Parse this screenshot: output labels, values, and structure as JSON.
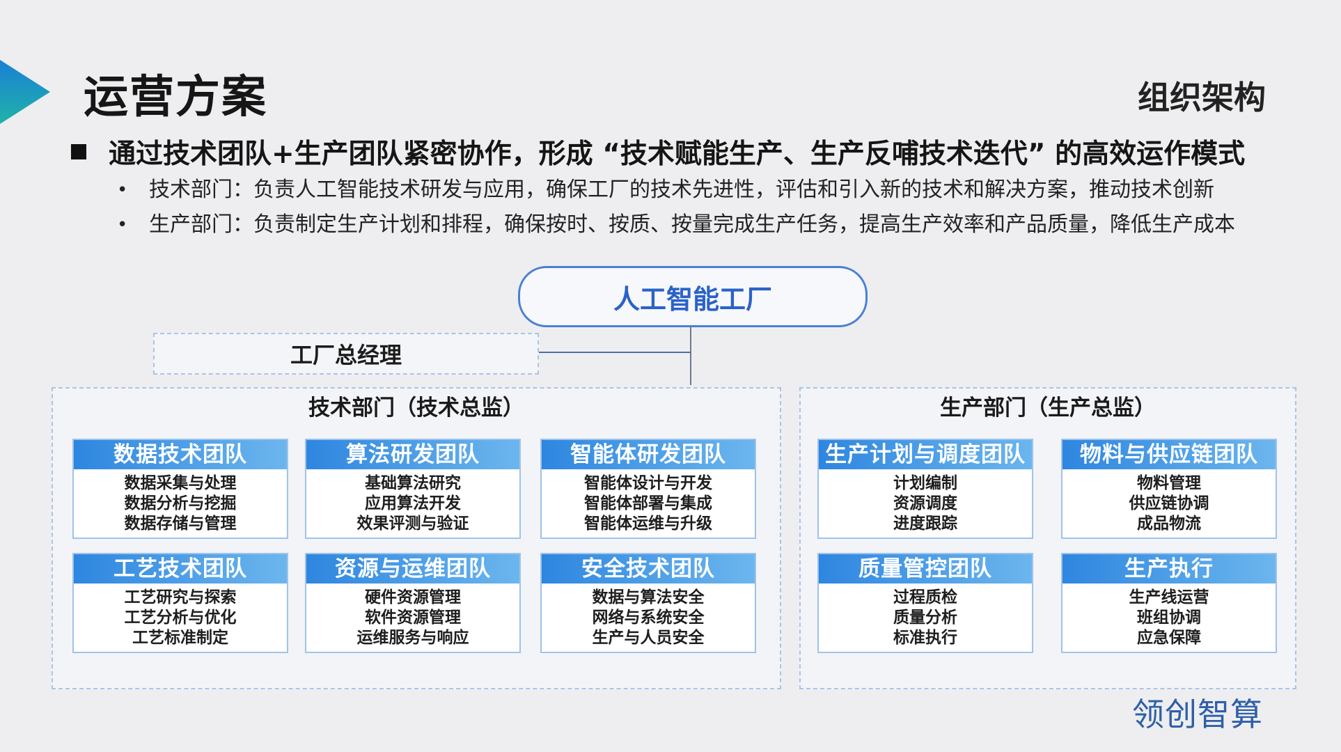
{
  "title": "运营方案",
  "section_label": "组织架构",
  "headline": "通过技术团队+生产团队紧密协作，形成 “技术赋能生产、生产反哺技术迭代” 的高效运作模式",
  "bullets": [
    "技术部门：负责人工智能技术研发与应用，确保工厂的技术先进性，评估和引入新的技术和解决方案，推动技术创新",
    "生产部门：负责制定生产计划和排程，确保按时、按质、按量完成生产任务，提高生产效率和产品质量，降低生产成本"
  ],
  "org": {
    "root": "人工智能工厂",
    "general_manager": "工厂总经理",
    "tech_dept": {
      "title": "技术部门（技术总监）",
      "teams": [
        {
          "name": "数据技术团队",
          "items": [
            "数据采集与处理",
            "数据分析与挖掘",
            "数据存储与管理"
          ]
        },
        {
          "name": "算法研发团队",
          "items": [
            "基础算法研究",
            "应用算法开发",
            "效果评测与验证"
          ]
        },
        {
          "name": "智能体研发团队",
          "items": [
            "智能体设计与开发",
            "智能体部署与集成",
            "智能体运维与升级"
          ]
        },
        {
          "name": "工艺技术团队",
          "items": [
            "工艺研究与探索",
            "工艺分析与优化",
            "工艺标准制定"
          ]
        },
        {
          "name": "资源与运维团队",
          "items": [
            "硬件资源管理",
            "软件资源管理",
            "运维服务与响应"
          ]
        },
        {
          "name": "安全技术团队",
          "items": [
            "数据与算法安全",
            "网络与系统安全",
            "生产与人员安全"
          ]
        }
      ]
    },
    "prod_dept": {
      "title": "生产部门（生产总监）",
      "teams": [
        {
          "name": "生产计划与调度团队",
          "items": [
            "计划编制",
            "资源调度",
            "进度跟踪"
          ]
        },
        {
          "name": "物料与供应链团队",
          "items": [
            "物料管理",
            "供应链协调",
            "成品物流"
          ]
        },
        {
          "name": "质量管控团队",
          "items": [
            "过程质检",
            "质量分析",
            "标准执行"
          ]
        },
        {
          "name": "生产执行",
          "items": [
            "生产线运营",
            "班组协调",
            "应急保障"
          ]
        }
      ]
    }
  },
  "brand": "领创智算",
  "colors": {
    "accent_blue": "#2e86df",
    "root_border": "#4a7fd6",
    "brand_text": "#2f5fa8"
  }
}
